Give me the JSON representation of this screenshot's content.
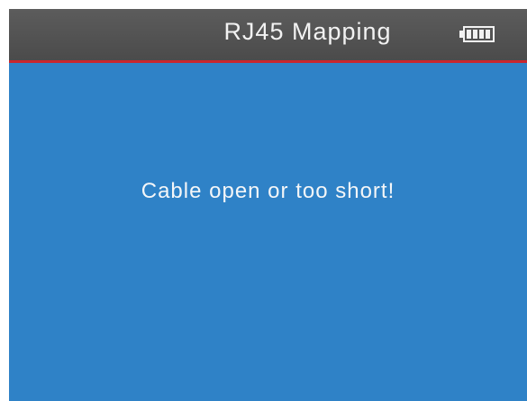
{
  "header": {
    "title": "RJ45 Mapping",
    "battery_icon": "battery-full-icon",
    "battery_level": 1.0
  },
  "main": {
    "message": "Cable open or too short!"
  },
  "colors": {
    "header_background": "#555555",
    "divider": "#c9262e",
    "screen_background": "#2f82c7",
    "text": "#f2f2f2"
  }
}
